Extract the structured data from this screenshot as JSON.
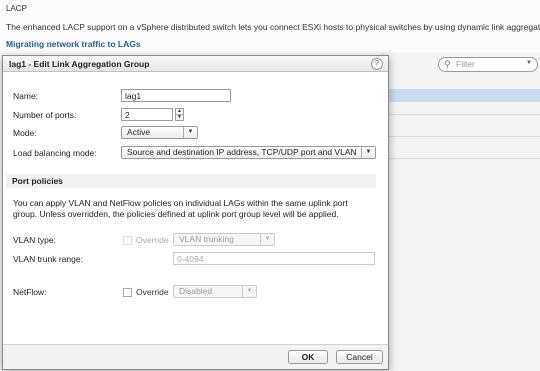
{
  "background": {
    "section_title": "LACP",
    "description": "The enhanced LACP support on a vSphere distributed switch lets you connect ESXi hosts to physical switches by using dynamic link aggregation.",
    "link": "Migrating network traffic to LAGs",
    "filter_placeholder": "Filter"
  },
  "dialog": {
    "title": "lag1 - Edit Link Aggregation Group",
    "help": "?",
    "name_label": "Name:",
    "name_value": "lag1",
    "ports_label": "Number of ports:",
    "ports_value": "2",
    "mode_label": "Mode:",
    "mode_value": "Active",
    "lb_label": "Load balancing mode:",
    "lb_value": "Source and destination IP address, TCP/UDP port and VLAN",
    "port_policies_title": "Port policies",
    "policy_text": "You can apply VLAN and NetFlow policies on individual LAGs within the same uplink port group. Unless overridden, the policies defined at uplink port group level will be applied.",
    "vlan_type_label": "VLAN type:",
    "vlan_override_label": "Override",
    "vlan_type_value": "VLAN trunking",
    "vlan_range_label": "VLAN trunk range:",
    "vlan_range_value": "0-4094",
    "netflow_label": "NetFlow:",
    "netflow_override_label": "Override",
    "netflow_value": "Disabled",
    "ok_label": "OK",
    "cancel_label": "Cancel"
  },
  "colors": {
    "link": "#2b5c8a",
    "selected_row": "#c8dcee"
  }
}
